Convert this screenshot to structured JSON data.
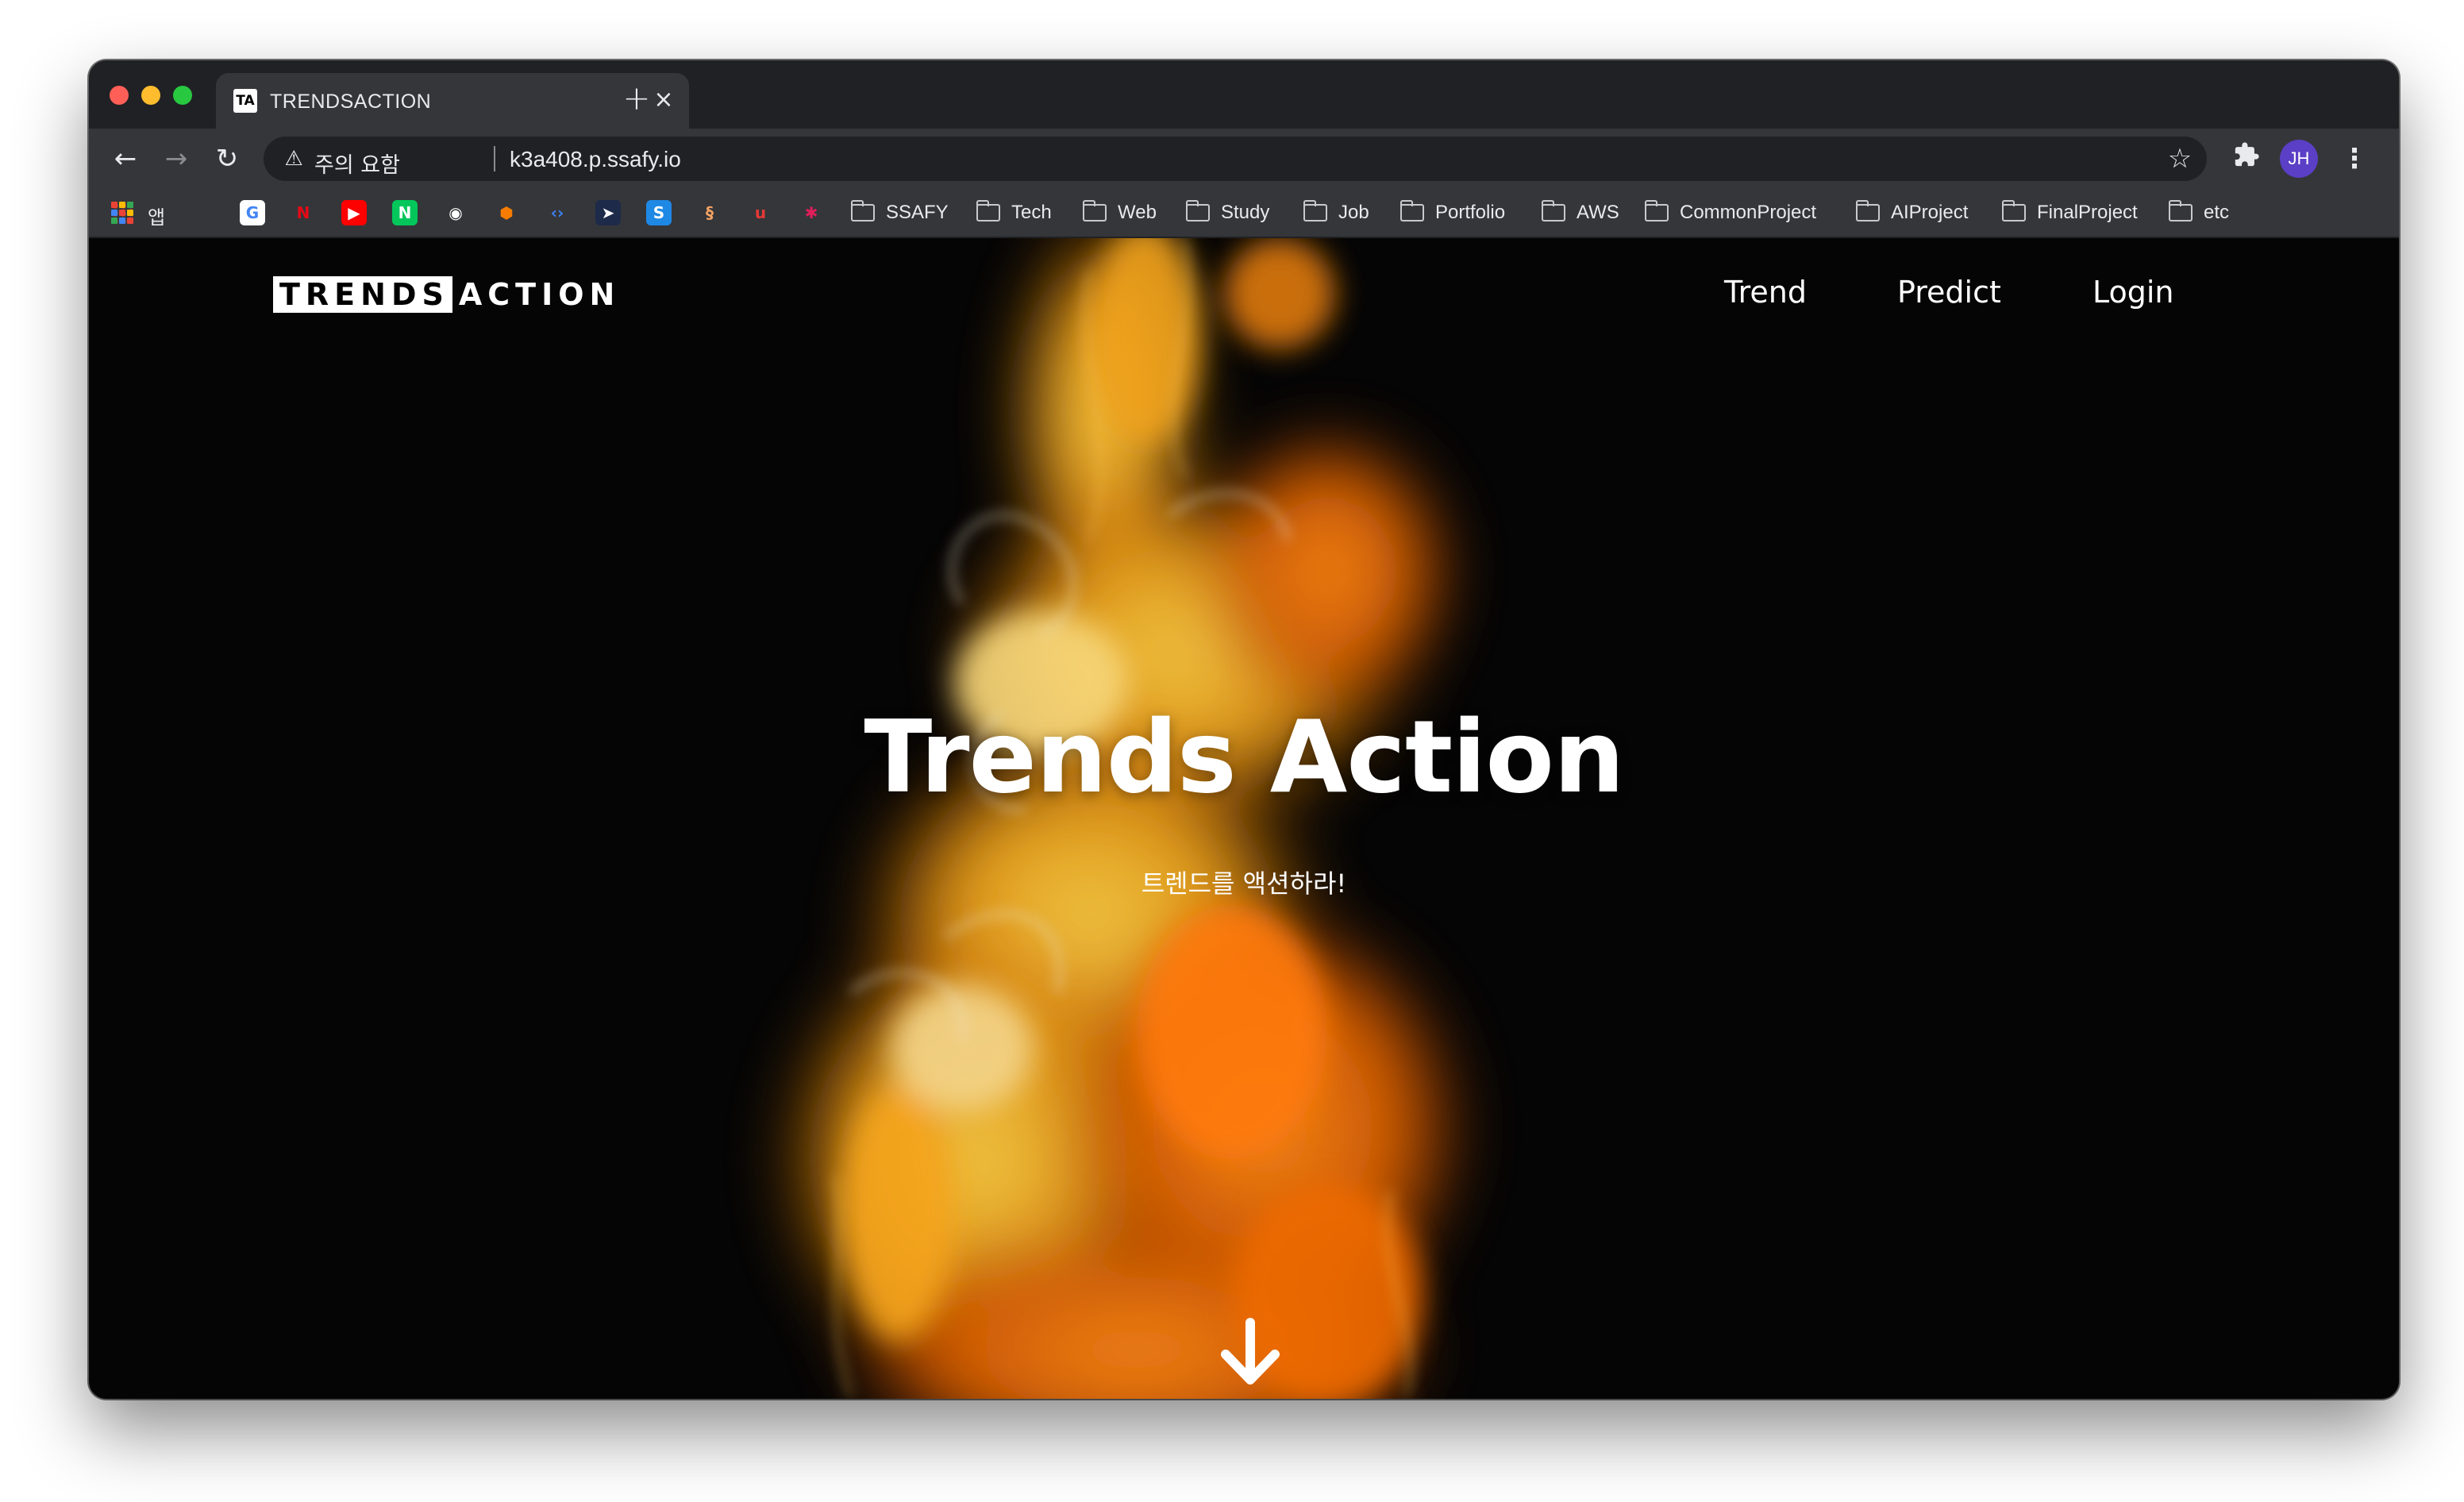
{
  "browser": {
    "tab": {
      "favicon": "TA",
      "title": "TRENDSACTION",
      "close": "×"
    },
    "new_tab": "+",
    "nav": {
      "back": "←",
      "forward": "→",
      "reload": "↻"
    },
    "address": {
      "security_icon": "⚠",
      "security_text": "주의 요함",
      "url": "k3a408.p.ssafy.io",
      "bookmark_star": "☆"
    },
    "extensions_icon": "puzzle-icon",
    "profile_initials": "JH",
    "menu": "⋮"
  },
  "bookmarks": {
    "apps_label": "앱",
    "icons": [
      {
        "name": "apple-icon",
        "glyph": "",
        "bg": "transparent",
        "color": "#c8c9cc"
      },
      {
        "name": "google-icon",
        "glyph": "G",
        "bg": "#ffffff",
        "color": "#4285f4"
      },
      {
        "name": "netflix-icon",
        "glyph": "N",
        "bg": "transparent",
        "color": "#e50914"
      },
      {
        "name": "youtube-icon",
        "glyph": "▶",
        "bg": "#ff0000",
        "color": "#ffffff"
      },
      {
        "name": "naver-icon",
        "glyph": "N",
        "bg": "#03c75a",
        "color": "#ffffff"
      },
      {
        "name": "github-icon",
        "glyph": "◉",
        "bg": "transparent",
        "color": "#ffffff"
      },
      {
        "name": "box-icon",
        "glyph": "⬢",
        "bg": "transparent",
        "color": "#f57c00"
      },
      {
        "name": "code-icon",
        "glyph": "‹›",
        "bg": "transparent",
        "color": "#3b82f6"
      },
      {
        "name": "send-icon",
        "glyph": "➤",
        "bg": "#1e2a4a",
        "color": "#ffffff"
      },
      {
        "name": "s-icon",
        "glyph": "S",
        "bg": "#1e88e5",
        "color": "#ffffff"
      },
      {
        "name": "flame-icon",
        "glyph": "§",
        "bg": "transparent",
        "color": "#f4a261"
      },
      {
        "name": "u-icon",
        "glyph": "u",
        "bg": "transparent",
        "color": "#e53935"
      },
      {
        "name": "slack-icon",
        "glyph": "✱",
        "bg": "transparent",
        "color": "#e01e5a"
      }
    ],
    "folders": [
      "SSAFY",
      "Tech",
      "Web",
      "Study",
      "Job",
      "Portfolio",
      "AWS",
      "CommonProject",
      "AIProject",
      "FinalProject",
      "etc"
    ]
  },
  "site": {
    "logo_boxed": "TRENDS",
    "logo_plain": "ACTION",
    "nav": [
      "Trend",
      "Predict",
      "Login"
    ],
    "hero_title": "Trends Action",
    "hero_subtitle": "트렌드를 액션하라!",
    "scroll_icon": "arrow-down-icon"
  },
  "colors": {
    "page_bg": "#050505",
    "smoke_yellow": "#f2b92a",
    "smoke_orange": "#e8720c",
    "profile": "#5b3fc6"
  }
}
